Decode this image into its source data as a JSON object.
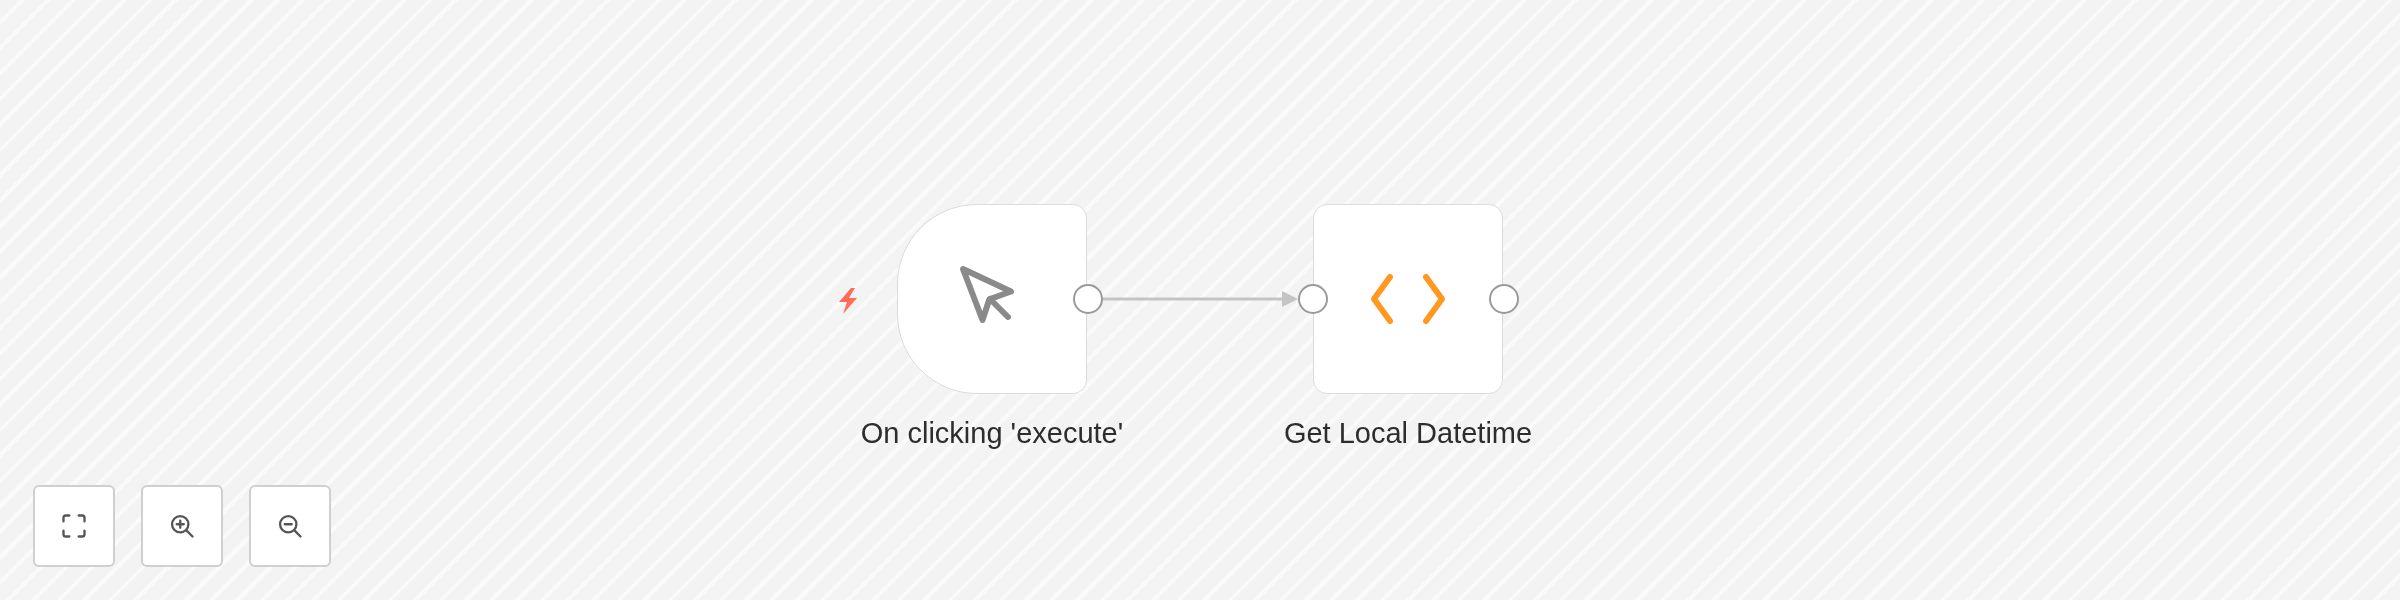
{
  "nodes": [
    {
      "kind": "trigger",
      "label": "On clicking 'execute'"
    },
    {
      "kind": "code",
      "label": "Get Local Datetime"
    }
  ],
  "controls": [
    {
      "kind": "fit"
    },
    {
      "kind": "zoom_in"
    },
    {
      "kind": "zoom_out"
    }
  ]
}
